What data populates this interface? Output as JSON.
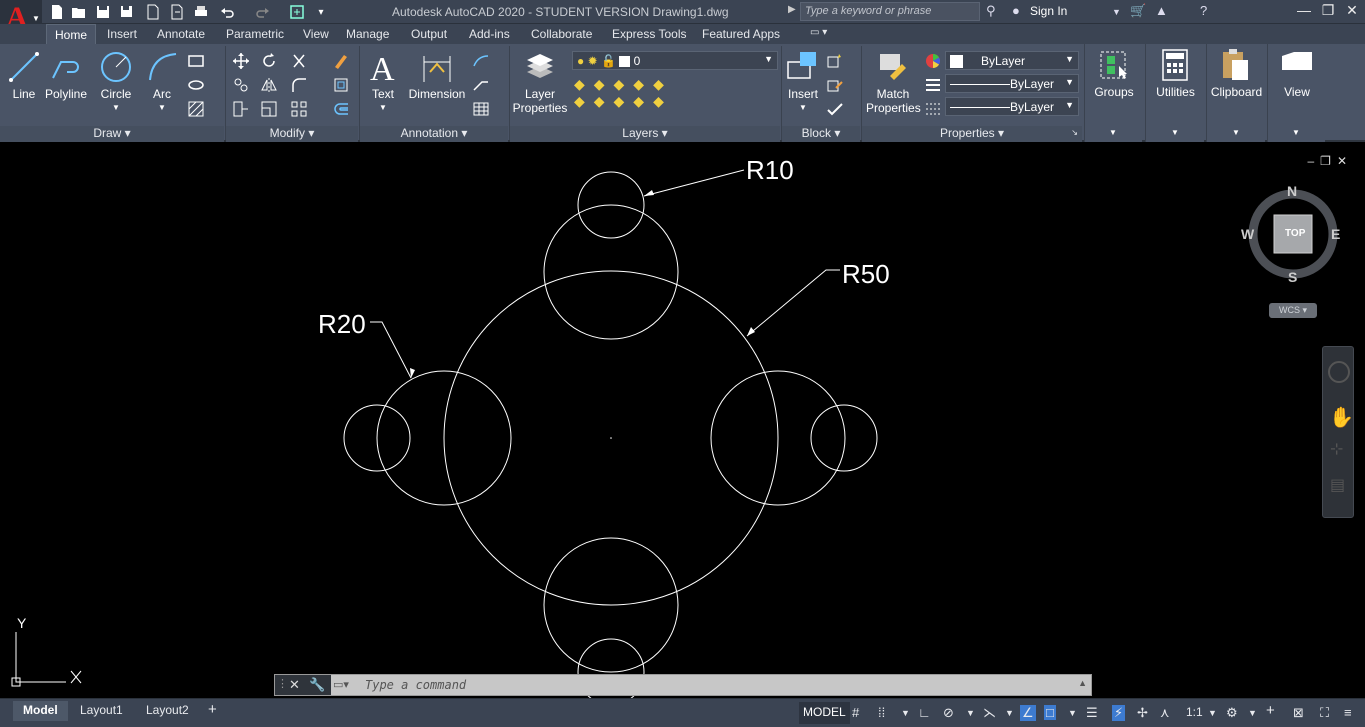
{
  "app": {
    "title": "Autodesk AutoCAD 2020 - STUDENT VERSION    Drawing1.dwg",
    "logo_letter": "A",
    "search_placeholder": "Type a keyword or phrase",
    "sign_in": "Sign In"
  },
  "ribbon_tabs": [
    "Home",
    "Insert",
    "Annotate",
    "Parametric",
    "View",
    "Manage",
    "Output",
    "Add-ins",
    "Collaborate",
    "Express Tools",
    "Featured Apps"
  ],
  "ribbon": {
    "draw": {
      "title": "Draw",
      "line": "Line",
      "polyline": "Polyline",
      "circle": "Circle",
      "arc": "Arc"
    },
    "modify": {
      "title": "Modify"
    },
    "annotation": {
      "title": "Annotation",
      "text": "Text",
      "dimension": "Dimension"
    },
    "layers": {
      "title": "Layers",
      "layer_properties_1": "Layer",
      "layer_properties_2": "Properties",
      "current_layer": "0"
    },
    "block": {
      "title": "Block",
      "insert": "Insert"
    },
    "properties": {
      "title": "Properties",
      "match_1": "Match",
      "match_2": "Properties",
      "color": "ByLayer",
      "linetype": "ByLayer",
      "lineweight": "ByLayer"
    },
    "groups": "Groups",
    "utilities": "Utilities",
    "clipboard": "Clipboard",
    "view": "View"
  },
  "drawing": {
    "labels": {
      "r10": "R10",
      "r50": "R50",
      "r20": "R20"
    },
    "viewcube": {
      "n": "N",
      "s": "S",
      "e": "E",
      "w": "W",
      "top": "TOP"
    },
    "wcs": "WCS",
    "ucs": {
      "x": "X",
      "y": "Y"
    }
  },
  "command": {
    "placeholder": "Type a command"
  },
  "status": {
    "layout_tabs": [
      "Model",
      "Layout1",
      "Layout2"
    ],
    "model": "MODEL",
    "scale": "1:1"
  },
  "colors": {
    "ribbon_bg": "#4a5466",
    "titlebar_bg": "#3b4453",
    "canvas_bg": "#000000",
    "geometry": "#ffffff",
    "logo_red": "#e02020"
  }
}
